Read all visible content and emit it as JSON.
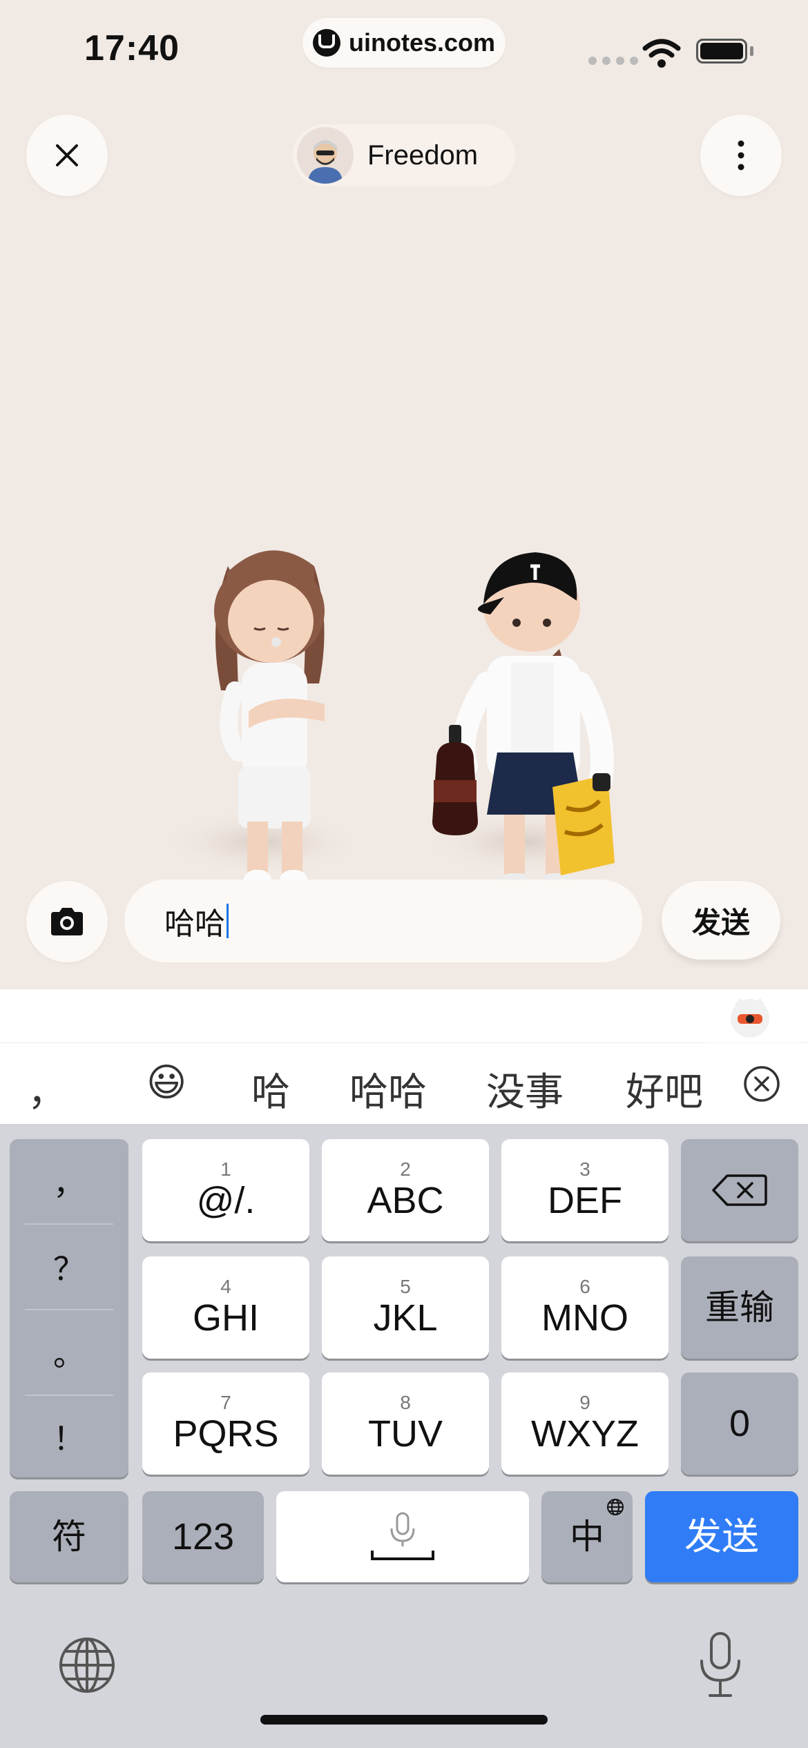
{
  "status": {
    "time": "17:40",
    "url": "uinotes.com"
  },
  "header": {
    "close_icon": "close-icon",
    "profile_name": "Freedom",
    "more_icon": "more-vertical-icon"
  },
  "composer": {
    "camera_icon": "camera-icon",
    "input_value": "哈哈",
    "send_label": "发送"
  },
  "candidates": {
    "items": [
      "，",
      "😃",
      "哈",
      "哈哈",
      "没事",
      "好吧"
    ],
    "clear_icon": "clear-circle-icon"
  },
  "keyboard": {
    "punctuation": [
      "，",
      "？",
      "。",
      "！"
    ],
    "keys": [
      {
        "num": "1",
        "label": "@/."
      },
      {
        "num": "2",
        "label": "ABC"
      },
      {
        "num": "3",
        "label": "DEF"
      },
      {
        "num": "4",
        "label": "GHI"
      },
      {
        "num": "5",
        "label": "JKL"
      },
      {
        "num": "6",
        "label": "MNO"
      },
      {
        "num": "7",
        "label": "PQRS"
      },
      {
        "num": "8",
        "label": "TUV"
      },
      {
        "num": "9",
        "label": "WXYZ"
      }
    ],
    "reset_label": "重输",
    "zero_label": "0",
    "symbols_label": "符",
    "numbers_label": "123",
    "lang_label": "中",
    "send_label": "发送"
  },
  "colors": {
    "accent": "#2f7cf6",
    "background": "#f1e9e3"
  }
}
